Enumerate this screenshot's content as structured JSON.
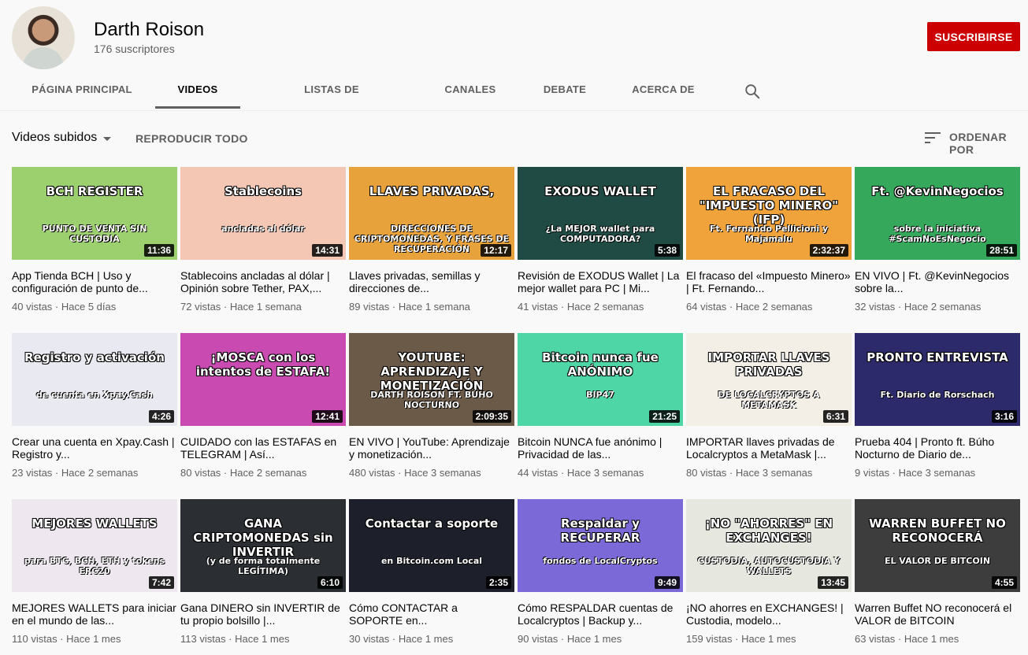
{
  "channel": {
    "name": "Darth Roison",
    "subscribers": "176 suscriptores",
    "subscribe_label": "SUSCRIBIRSE"
  },
  "tabs": [
    {
      "label": "PÁGINA PRINCIPAL",
      "active": false
    },
    {
      "label": "VIDEOS",
      "active": true
    },
    {
      "label": "LISTAS DE REPRODUCCIÓN",
      "active": false
    },
    {
      "label": "CANALES",
      "active": false
    },
    {
      "label": "DEBATE",
      "active": false
    },
    {
      "label": "ACERCA DE",
      "active": false
    }
  ],
  "search_icon": "search-icon",
  "subnav": {
    "title": "Videos subidos",
    "play_all": "REPRODUCIR TODO",
    "sort_label": "ORDENAR POR"
  },
  "colors": {
    "subscribe": "#cc0000",
    "text_secondary": "#606060",
    "background": "#f9f9f9"
  },
  "videos": [
    {
      "title": "App Tienda BCH | Uso y configuración de punto de...",
      "meta": "40 vistas · Hace 5 días",
      "duration": "11:36",
      "thumb_text": "BCH REGISTER",
      "thumb_sub": "PUNTO DE VENTA SIN CUSTODIA",
      "bg": "#9ccf6e"
    },
    {
      "title": "Stablecoins ancladas al dólar | Opinión sobre Tether, PAX,...",
      "meta": "72 vistas · Hace 1 semana",
      "duration": "14:31",
      "thumb_text": "Stablecoins",
      "thumb_sub": "ancladas al dólar",
      "bg": "#f3c7b4"
    },
    {
      "title": "Llaves privadas, semillas y direcciones de...",
      "meta": "89 vistas · Hace 1 semana",
      "duration": "12:17",
      "thumb_text": "LLAVES PRIVADAS,",
      "thumb_sub": "DIRECCIONES DE CRIPTOMONEDAS, Y FRASES DE RECUPERACIÓN",
      "bg": "#e8a23c"
    },
    {
      "title": "Revisión de EXODUS Wallet | La mejor wallet para PC | Mi...",
      "meta": "41 vistas · Hace 2 semanas",
      "duration": "5:38",
      "thumb_text": "EXODUS WALLET",
      "thumb_sub": "¿La MEJOR wallet para COMPUTADORA?",
      "bg": "#1f4b44"
    },
    {
      "title": "El fracaso del «Impuesto Minero» | Ft. Fernando...",
      "meta": "64 vistas · Hace 2 semanas",
      "duration": "2:32:37",
      "thumb_text": "EL FRACASO DEL \"IMPUESTO MINERO\" (IFP)",
      "thumb_sub": "Ft. Fernando Pellicioni y Majamalu",
      "bg": "#f0a33b"
    },
    {
      "title": "EN VIVO | Ft. @KevinNegocios sobre la...",
      "meta": "32 vistas · Hace 2 semanas",
      "duration": "28:51",
      "thumb_text": "Ft. @KevinNegocios",
      "thumb_sub": "sobre la iniciativa #ScamNoEsNegocio",
      "bg": "#36a85c"
    },
    {
      "title": "Crear una cuenta en Xpay.Cash | Registro y...",
      "meta": "23 vistas · Hace 2 semanas",
      "duration": "4:26",
      "thumb_text": "Registro y activación",
      "thumb_sub": "de cuenta en Xpay.Cash",
      "bg": "#e9e9f2"
    },
    {
      "title": "CUIDADO con las ESTAFAS en TELEGRAM | Así...",
      "meta": "80 vistas · Hace 2 semanas",
      "duration": "12:41",
      "thumb_text": "¡MOSCA con los intentos de ESTAFA!",
      "thumb_sub": "",
      "bg": "#c94ab0"
    },
    {
      "title": "EN VIVO | YouTube: Aprendizaje y monetización...",
      "meta": "480 vistas · Hace 3 semanas",
      "duration": "2:09:35",
      "thumb_text": "YOUTUBE: APRENDIZAJE Y MONETIZACIÓN",
      "thumb_sub": "DARTH ROISON FT. BÚHO NOCTURNO",
      "bg": "#6b5a48"
    },
    {
      "title": "Bitcoin NUNCA fue anónimo | Privacidad de las...",
      "meta": "44 vistas · Hace 3 semanas",
      "duration": "21:25",
      "thumb_text": "Bitcoin nunca fue ANÓNIMO",
      "thumb_sub": "BIP47",
      "bg": "#4fd6a6"
    },
    {
      "title": "IMPORTAR llaves privadas de Localcryptos a MetaMask |...",
      "meta": "80 vistas · Hace 3 semanas",
      "duration": "6:31",
      "thumb_text": "IMPORTAR LLAVES PRIVADAS",
      "thumb_sub": "DE LOCALCRYPTOS A METAMASK",
      "bg": "#f3efe6"
    },
    {
      "title": "Prueba 404 | Pronto ft. Búho Nocturno de Diario de...",
      "meta": "9 vistas · Hace 3 semanas",
      "duration": "3:16",
      "thumb_text": "PRONTO ENTREVISTA",
      "thumb_sub": "Ft. Diario de Rorschach",
      "bg": "#2d2a6b"
    },
    {
      "title": "MEJORES WALLETS para iniciar en el mundo de las...",
      "meta": "110 vistas · Hace 1 mes",
      "duration": "7:42",
      "thumb_text": "MEJORES WALLETS",
      "thumb_sub": "para BTC, BCH, ETH y tokens ERC20",
      "bg": "#efe7f0"
    },
    {
      "title": "Gana DINERO sin INVERTIR de tu propio bolsillo |...",
      "meta": "113 vistas · Hace 1 mes",
      "duration": "6:10",
      "thumb_text": "GANA CRIPTOMONEDAS sin INVERTIR",
      "thumb_sub": "(y de forma totalmente LEGÍTIMA)",
      "bg": "#2b2e33"
    },
    {
      "title": "Cómo CONTACTAR a SOPORTE en...",
      "meta": "30 vistas · Hace 1 mes",
      "duration": "2:35",
      "thumb_text": "Contactar a soporte",
      "thumb_sub": "en Bitcoin.com Local",
      "bg": "#1d1f2b"
    },
    {
      "title": "Cómo RESPALDAR cuentas de Localcryptos | Backup y...",
      "meta": "90 vistas · Hace 1 mes",
      "duration": "9:49",
      "thumb_text": "Respaldar y RECUPERAR",
      "thumb_sub": "fondos de LocalCryptos",
      "bg": "#7a69d6"
    },
    {
      "title": "¡NO ahorres en EXCHANGES! | Custodia, modelo...",
      "meta": "159 vistas · Hace 1 mes",
      "duration": "13:45",
      "thumb_text": "¡NO \"AHORRES\" EN EXCHANGES!",
      "thumb_sub": "CUSTODIA, AUTOCUSTODIA Y WALLETS",
      "bg": "#e6e8e0"
    },
    {
      "title": "Warren Buffet NO reconocerá el VALOR de BITCOIN",
      "meta": "63 vistas · Hace 1 mes",
      "duration": "4:55",
      "thumb_text": "WARREN BUFFET NO RECONOCERÁ",
      "thumb_sub": "EL VALOR DE BITCOIN",
      "bg": "#3d3d3d"
    }
  ]
}
